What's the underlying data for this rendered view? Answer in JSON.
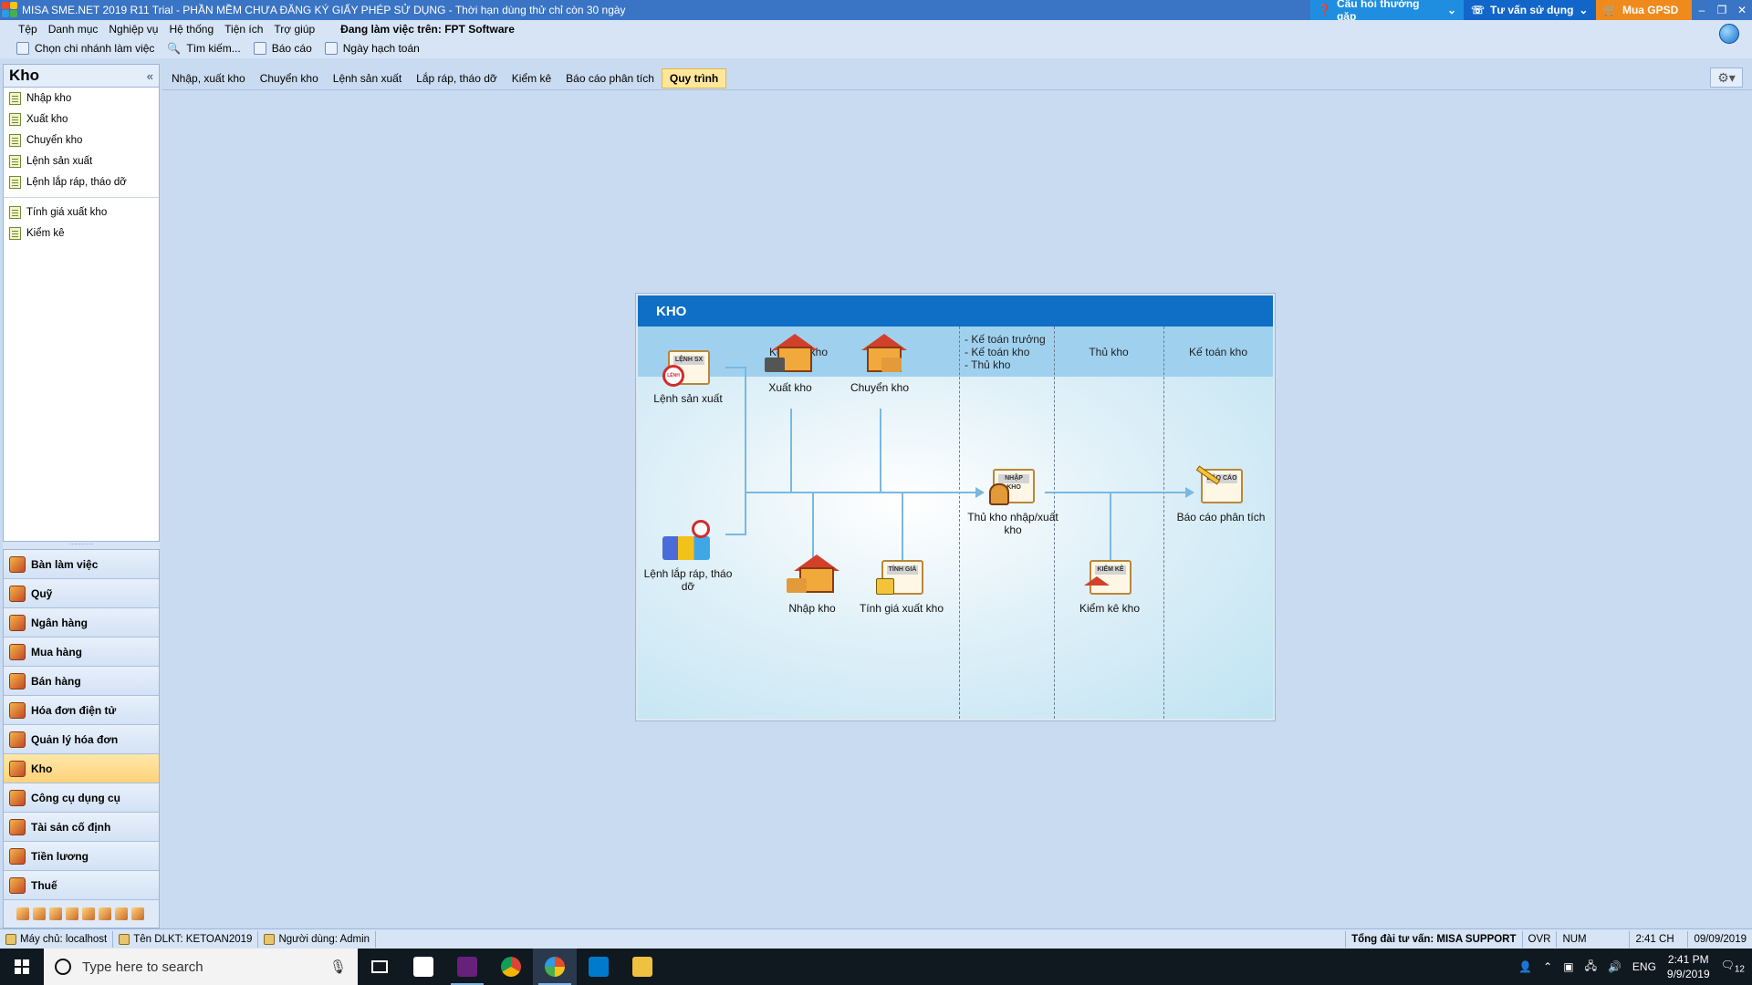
{
  "window": {
    "title": "MISA SME.NET 2019 R11 Trial - PHẦN MỀM CHƯA ĐĂNG KÝ GIẤY PHÉP SỬ DỤNG - Thời hạn dùng thử chỉ còn 30 ngày",
    "faq": "Câu hỏi thường gặp",
    "consult": "Tư vấn sử dụng",
    "buy": "Mua GPSD",
    "minimize": "–",
    "restore": "❐",
    "close": "✕"
  },
  "menu": [
    "Tệp",
    "Danh mục",
    "Nghiệp vụ",
    "Hệ thống",
    "Tiện ích",
    "Trợ giúp"
  ],
  "working_on": "Đang làm việc trên: FPT Software",
  "toolbar": [
    "Chọn chi nhánh làm việc",
    "Tìm kiếm...",
    "Báo cáo",
    "Ngày hạch toán"
  ],
  "sidebar": {
    "title": "Kho",
    "collapse": "«",
    "items": [
      "Nhập kho",
      "Xuất kho",
      "Chuyển kho",
      "Lệnh sản xuất",
      "Lệnh lắp ráp, tháo dỡ"
    ],
    "items2": [
      "Tính giá xuất kho",
      "Kiểm kê"
    ],
    "grip": "··········",
    "modules": [
      "Bàn làm việc",
      "Quỹ",
      "Ngân hàng",
      "Mua hàng",
      "Bán hàng",
      "Hóa đơn điện tử",
      "Quản lý hóa đơn",
      "Kho",
      "Công cụ dụng cụ",
      "Tài sản cố định",
      "Tiền lương",
      "Thuế"
    ],
    "active_module": "Kho"
  },
  "tabs": [
    "Nhập, xuất kho",
    "Chuyển kho",
    "Lệnh sản xuất",
    "Lắp ráp, tháo dỡ",
    "Kiểm kê",
    "Báo cáo phân tích",
    "Quy trình"
  ],
  "active_tab": "Quy trình",
  "diagram": {
    "title": "KHO",
    "lanes": [
      "Kế toán kho",
      "- Kế toán trưởng\n- Kế toán kho\n- Thủ kho",
      "Thủ kho",
      "Kế toán kho"
    ],
    "nodes": {
      "lenh_sx": "Lệnh sản xuất",
      "xuat_kho": "Xuất kho",
      "chuyen_kho": "Chuyển kho",
      "lenh_lap_rap": "Lệnh lắp ráp, tháo dỡ",
      "nhap_kho": "Nhập kho",
      "tinh_gia": "Tính giá xuất kho",
      "thu_kho": "Thủ kho nhập/xuất kho",
      "kiem_ke": "Kiểm kê kho",
      "bao_cao": "Báo cáo phân tích"
    },
    "badges": {
      "lenh_sx": "LỆNH SX",
      "lenh": "LỆNH",
      "nhap_kho": "NHẬP KHO",
      "tinh_gia": "TÍNH GIÁ",
      "kiem_ke": "KIỂM KÊ",
      "bao_cao": "BÁO CÁO"
    }
  },
  "statusbar": {
    "server": "Máy chủ: localhost",
    "db": "Tên DLKT: KETOAN2019",
    "user": "Người dùng: Admin",
    "hotline": "Tổng đài tư vấn: MISA SUPPORT",
    "ovr": "OVR",
    "num": "NUM",
    "time": "2:41 CH",
    "date": "09/09/2019"
  },
  "taskbar": {
    "search_placeholder": "Type here to search",
    "lang": "ENG",
    "time": "2:41 PM",
    "date": "9/9/2019",
    "notif": "12"
  }
}
